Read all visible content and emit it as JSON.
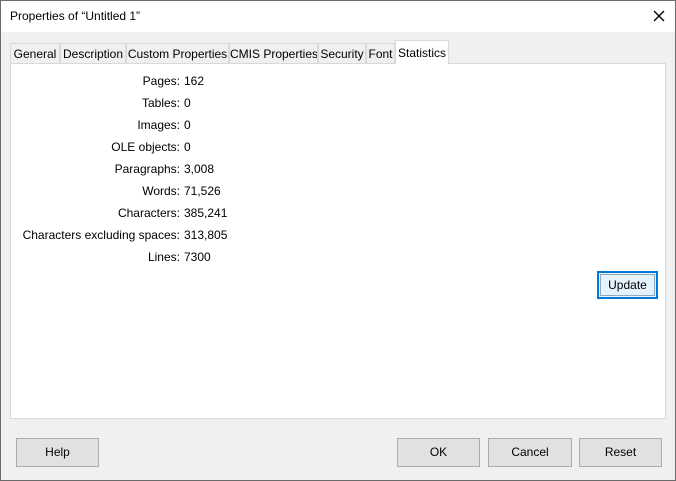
{
  "window": {
    "title": "Properties of “Untitled 1”"
  },
  "tabs": [
    {
      "label": "General"
    },
    {
      "label": "Description"
    },
    {
      "label": "Custom Properties"
    },
    {
      "label": "CMIS Properties"
    },
    {
      "label": "Security"
    },
    {
      "label": "Font"
    },
    {
      "label": "Statistics",
      "active": true
    }
  ],
  "statistics": {
    "rows": [
      {
        "label": "Pages:",
        "value": "162"
      },
      {
        "label": "Tables:",
        "value": "0"
      },
      {
        "label": "Images:",
        "value": "0"
      },
      {
        "label": "OLE objects:",
        "value": "0"
      },
      {
        "label": "Paragraphs:",
        "value": "3,008"
      },
      {
        "label": "Words:",
        "value": "71,526"
      },
      {
        "label": "Characters:",
        "value": "385,241"
      },
      {
        "label": "Characters excluding spaces:",
        "value": "313,805"
      },
      {
        "label": "Lines:",
        "value": "7300"
      }
    ],
    "update_label": "Update"
  },
  "footer": {
    "help_label": "Help",
    "ok_label": "OK",
    "cancel_label": "Cancel",
    "reset_label": "Reset"
  },
  "icons": {
    "close": "close-icon"
  },
  "colors": {
    "default_button_border": "#0078d7",
    "panel_background": "#ffffff",
    "dialog_background": "#f0f0f0"
  }
}
